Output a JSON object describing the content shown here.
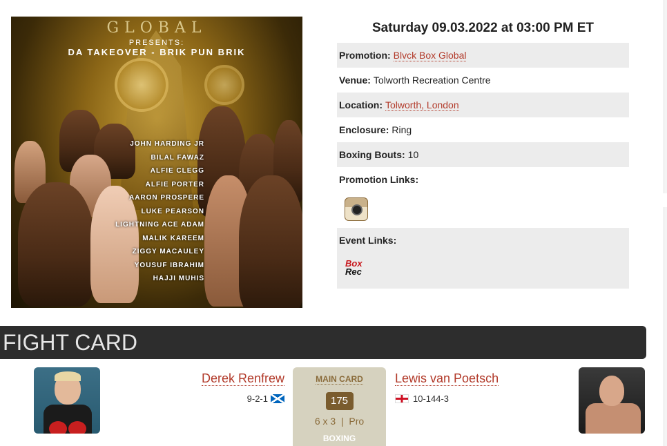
{
  "poster": {
    "brand": "GLOBAL",
    "presents": "PRESENTS:",
    "event": "DA TAKEOVER - BRIK PUN BRIK",
    "fighters": [
      "JOHN HARDING JR",
      "BILAL FAWAZ",
      "ALFIE CLEGG",
      "ALFIE PORTER",
      "AARON PROSPERE",
      "LUKE PEARSON",
      "LIGHTNING ACE ADAM",
      "MALIK KAREEM",
      "ZIGGY MACAULEY",
      "YOUSUF IBRAHIM",
      "HAJJI MUHIS"
    ]
  },
  "event": {
    "datetime": "Saturday 09.03.2022 at 03:00 PM ET",
    "promotion_label": "Promotion:",
    "promotion_value": "Blvck Box Global",
    "venue_label": "Venue:",
    "venue_value": "Tolworth Recreation Centre",
    "location_label": "Location:",
    "location_value": "Tolworth, London",
    "enclosure_label": "Enclosure:",
    "enclosure_value": "Ring",
    "bouts_label": "Boxing Bouts:",
    "bouts_value": "10",
    "promotion_links_label": "Promotion Links:",
    "promotion_links_icon": "instagram-icon",
    "event_links_label": "Event Links:",
    "boxrec_top": "Box",
    "boxrec_bottom": "Rec"
  },
  "fight_card": {
    "title": "FIGHT CARD",
    "bout": {
      "left_name": "Derek Renfrew",
      "left_record": "9-2-1",
      "left_flag": "scotland-flag",
      "category": "MAIN CARD",
      "weight": "175",
      "rounds": "6 x 3  |  Pro",
      "sport": "BOXING",
      "right_name": "Lewis van Poetsch",
      "right_record": "10-144-3",
      "right_flag": "england-flag"
    }
  },
  "colors": {
    "link": "#b23a2a",
    "row_shade": "#ececec",
    "fight_bar": "#2d2d2d",
    "center_box": "#d6d2bf",
    "weight_badge": "#7a5c2e"
  }
}
